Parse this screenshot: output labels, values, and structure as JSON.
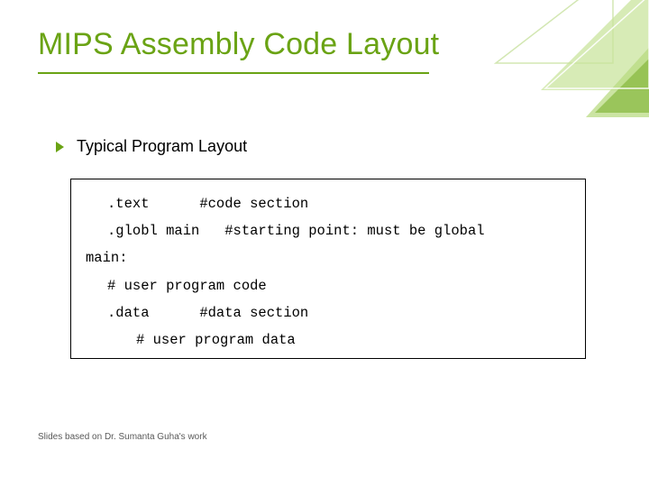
{
  "title": "MIPS Assembly Code Layout",
  "bullet": "Typical Program Layout",
  "code": {
    "l1": ".text      #code section",
    "l2": ".globl main   #starting point: must be global",
    "l3": "main:",
    "l4": "# user program code",
    "l5": ".data      #data section",
    "l6": "# user program data"
  },
  "footer": "Slides based on Dr. Sumanta Guha's work"
}
